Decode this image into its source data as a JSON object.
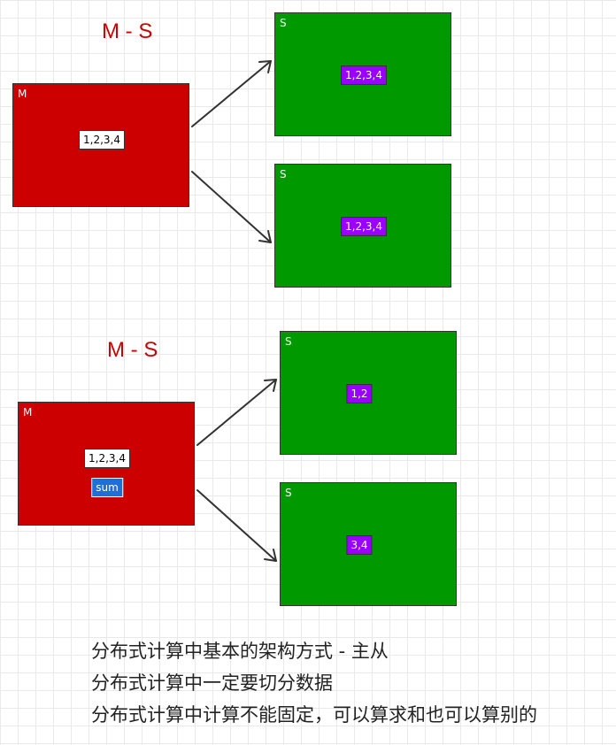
{
  "diagrams": [
    {
      "title": "M - S",
      "master": {
        "label": "M",
        "data": "1,2,3,4"
      },
      "slaves": [
        {
          "label": "S",
          "data": "1,2,3,4"
        },
        {
          "label": "S",
          "data": "1,2,3,4"
        }
      ]
    },
    {
      "title": "M - S",
      "master": {
        "label": "M",
        "data": "1,2,3,4",
        "extra": "sum"
      },
      "slaves": [
        {
          "label": "S",
          "data": "1,2"
        },
        {
          "label": "S",
          "data": "3,4"
        }
      ]
    }
  ],
  "notes": [
    "分布式计算中基本的架构方式 - 主从",
    "分布式计算中一定要切分数据",
    "分布式计算中计算不能固定，可以算求和也可以算别的"
  ],
  "colors": {
    "master": "#cc0000",
    "slave": "#009900",
    "title": "#cc0000",
    "tag_purple": "#9900ff",
    "tag_blue": "#1e6fd9",
    "arrow": "#333333"
  }
}
